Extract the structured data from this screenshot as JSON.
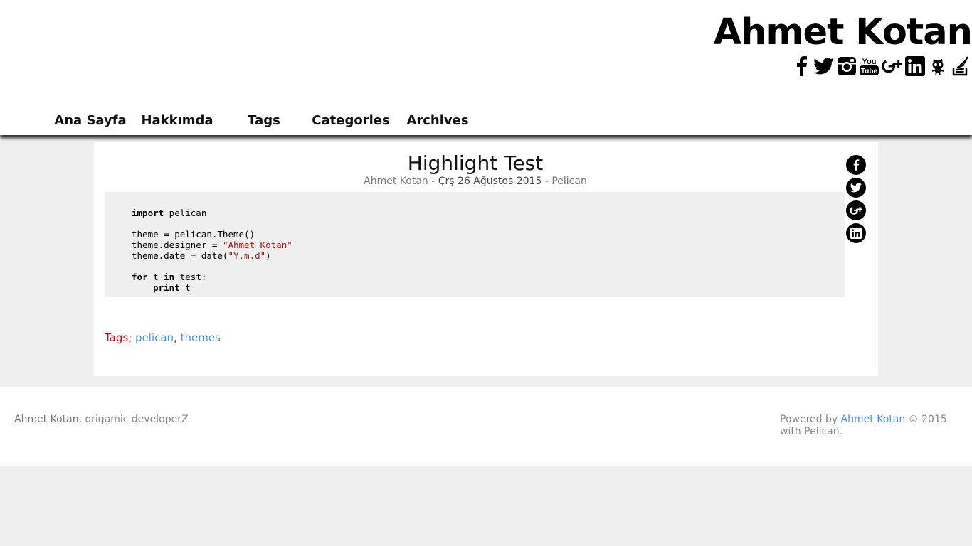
{
  "header": {
    "site_title": "Ahmet Kotan",
    "social_icons": [
      "facebook-icon",
      "twitter-icon",
      "instagram-icon",
      "youtube-icon",
      "google-plus-icon",
      "linkedin-icon",
      "github-icon",
      "stackoverflow-icon"
    ],
    "youtube_top": "You",
    "youtube_bottom": "Tube"
  },
  "nav": {
    "items": [
      "Ana Sayfa",
      "Hakkımda",
      "Tags",
      "Categories",
      "Archives"
    ]
  },
  "article": {
    "title": "Highlight Test",
    "author": "Ahmet Kotan",
    "sep1": " - ",
    "date": "Çrş 26 Ağustos 2015",
    "sep2": " - ",
    "category": "Pelican",
    "code": {
      "kw_import": "import",
      "mod_pelican": " pelican",
      "line2": "theme = pelican.Theme()",
      "line3_a": "theme.designer = ",
      "line3_str": "\"Ahmet Kotan\"",
      "line4_a": "theme.date = date(",
      "line4_str": "\"Y.m.d\"",
      "line4_b": ")",
      "kw_for": "for",
      "for_t": " t ",
      "kw_in": "in",
      "for_rest": " test:",
      "indent": "    ",
      "kw_print": "print",
      "print_rest": " t"
    },
    "tags_label": "Tags;",
    "tags": [
      "pelican",
      "themes"
    ],
    "tag_separator": ",",
    "share_icons": [
      "facebook-icon",
      "twitter-icon",
      "google-plus-icon",
      "linkedin-icon"
    ]
  },
  "footer": {
    "author": "Ahmet Kotan",
    "tagline": ", origamic developerZ",
    "powered_prefix": "Powered by ",
    "powered_link": "Ahmet Kotan",
    "powered_suffix": " © 2015 with Pelican."
  },
  "colors": {
    "page_bg": "#efefef",
    "link": "#4a90e2",
    "tags_label": "#e00000",
    "code_string": "#a31515"
  }
}
